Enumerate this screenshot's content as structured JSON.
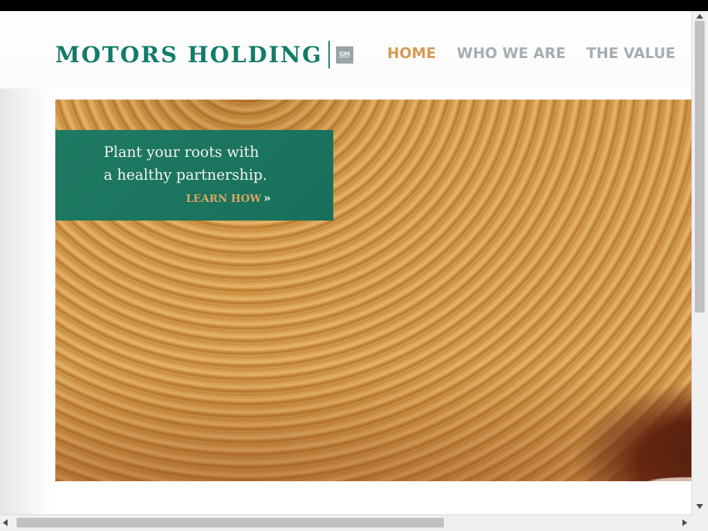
{
  "brand": {
    "name": "MOTORS HOLDING",
    "badge": "GM",
    "color": "#137b6a"
  },
  "nav": {
    "items": [
      {
        "label": "HOME",
        "active": true
      },
      {
        "label": "WHO WE ARE",
        "active": false
      },
      {
        "label": "THE VALUE",
        "active": false
      }
    ],
    "active_color": "#d69a55",
    "inactive_color": "#a6aeb3"
  },
  "hero": {
    "image": "tree-rings-wood-cross-section",
    "promo": {
      "line1": "Plant your roots with",
      "line2": "a healthy partnership.",
      "link_label": "LEARN HOW",
      "link_arrow": "»",
      "background": "#1c7560",
      "link_color": "#d8a760"
    }
  },
  "icons": {
    "scroll_up": "arrow-up-icon",
    "scroll_down": "arrow-down-icon",
    "scroll_left": "arrow-left-icon",
    "scroll_right": "arrow-right-icon"
  }
}
